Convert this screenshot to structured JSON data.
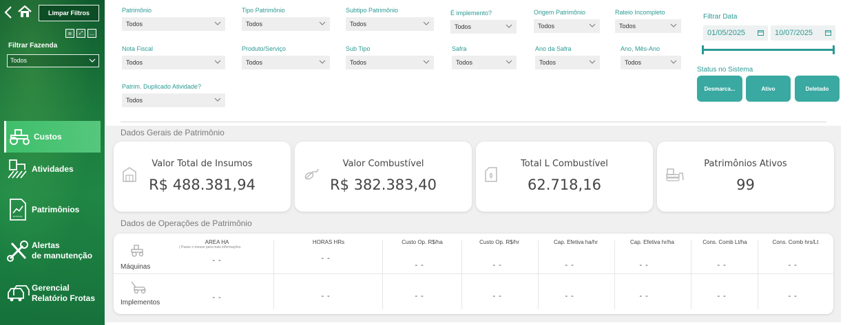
{
  "sidebar": {
    "clear_filters_label": "Limpar Filtros",
    "farm_filter_label": "Filtrar Fazenda",
    "farm_filter_value": "Todos",
    "nav": [
      {
        "label": "Custos",
        "icon": "tractor-icon",
        "active": true
      },
      {
        "label": "Atividades",
        "icon": "field-icon",
        "active": false
      },
      {
        "label": "Patrimônios",
        "icon": "report-chart-icon",
        "active": false
      },
      {
        "label": "Alertas de manutenção",
        "line1": "Alertas",
        "line2": "de manutenção",
        "icon": "wrench-icon",
        "active": false
      },
      {
        "label": "Gerencial Relatório Frotas",
        "line1": "Gerencial",
        "line2": "Relatório Frotas",
        "icon": "cars-icon",
        "active": false
      }
    ]
  },
  "filters": {
    "patrimonio": {
      "label": "Patrimônio",
      "value": "Todos"
    },
    "tipo_patrimonio": {
      "label": "Tipo Patrimônio",
      "value": "Todos"
    },
    "subtipo_patrimonio": {
      "label": "Subtipo Patrimônio",
      "value": "Todos"
    },
    "e_implemento": {
      "label": "É implemento?",
      "value": "Todos"
    },
    "origem_patrimonio": {
      "label": "Origem Patrimônio",
      "value": "Todos"
    },
    "rateio_incompleto": {
      "label": "Rateio Incompleto",
      "value": "Todos"
    },
    "nota_fiscal": {
      "label": "Nota Fiscal",
      "value": "Todos"
    },
    "produto_servico": {
      "label": "Produto/Serviço",
      "value": "Todos"
    },
    "sub_tipo": {
      "label": "Sub Tipo",
      "value": "Todos"
    },
    "safra": {
      "label": "Safra",
      "value": "Todos"
    },
    "ano_da_safra": {
      "label": "Ano da Safra",
      "value": "Todos"
    },
    "ano_mes_ano": {
      "label": "Ano, Mês-Ano",
      "value": "Todos"
    },
    "patrim_duplicado": {
      "label": "Patrim. Duplicado Atividade?",
      "value": "Todos"
    }
  },
  "date_filter": {
    "label": "Filtrar Data",
    "start": "01/05/2025",
    "end": "10/07/2025"
  },
  "status": {
    "label": "Status no Sistema",
    "buttons": [
      "Desmarca...",
      "Ativo",
      "Deletado"
    ]
  },
  "sections": {
    "general": "Dados Gerais de Patrimônio",
    "operations": "Dados de Operações de Patrimônio"
  },
  "kpis": [
    {
      "title": "Valor Total de Insumos",
      "value": "R$ 488.381,94",
      "icon": "warehouse-icon"
    },
    {
      "title": "Valor Combustível",
      "value": "R$ 382.383,40",
      "icon": "fuel-nozzle-icon"
    },
    {
      "title": "Total L Combustível",
      "value": "62.718,16",
      "icon": "fuel-can-icon"
    },
    {
      "title": "Patrimônios Ativos",
      "value": "99",
      "icon": "bulldozer-icon"
    }
  ],
  "operations": {
    "columns": [
      "AREA HA",
      "HORAS HRs",
      "Custo Op. R$/ha",
      "Custo Op. R$/hr",
      "Cap. Efetiva ha/hr",
      "Cap. Efetiva hr/ha",
      "Cons. Comb Lt/ha",
      "Cons. Comb hrs/Lt"
    ],
    "hint": "( Passe o mouse para mais informações",
    "rows": [
      {
        "label": "Máquinas",
        "icon": "tractor-icon",
        "values": [
          "--",
          "--",
          "--",
          "--",
          "--",
          "--",
          "--",
          "--"
        ]
      },
      {
        "label": "Implementos",
        "icon": "mower-icon",
        "values": [
          "--",
          "--",
          "--",
          "--",
          "--",
          "--",
          "--",
          "--"
        ]
      }
    ]
  },
  "colors": {
    "accent": "#2a9a93",
    "button": "#3aa9a2",
    "sidebar_dark": "#0f5a2d",
    "nav_active": "#3fbf6a"
  }
}
